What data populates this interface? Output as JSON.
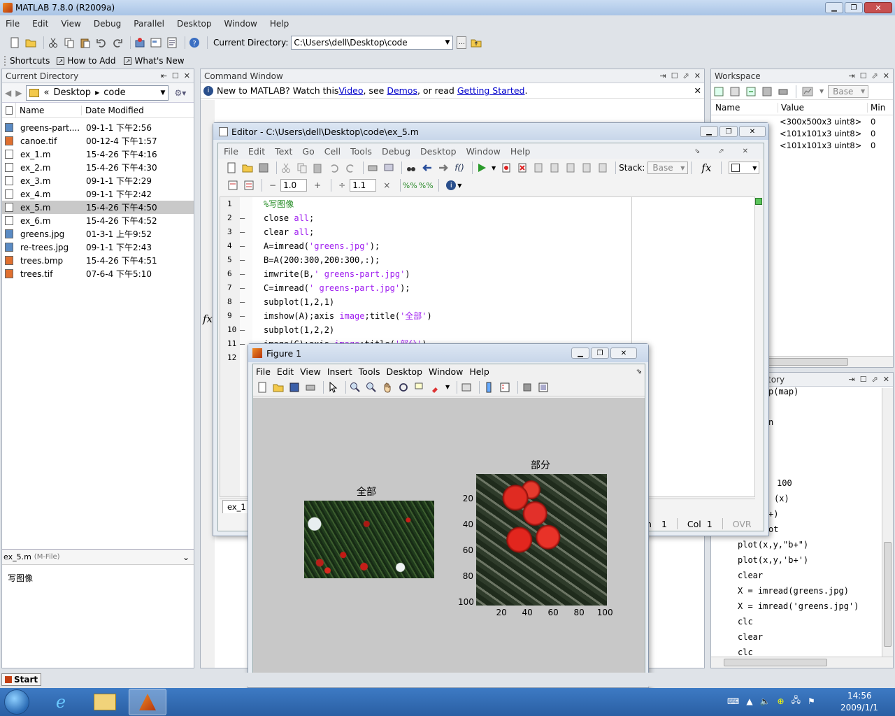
{
  "app": {
    "title": "MATLAB  7.8.0 (R2009a)"
  },
  "menubar": [
    "File",
    "Edit",
    "View",
    "Debug",
    "Parallel",
    "Desktop",
    "Window",
    "Help"
  ],
  "toolbar": {
    "curdir_label": "Current Directory:",
    "curdir_value": "C:\\Users\\dell\\Desktop\\code"
  },
  "shortcuts": {
    "label": "Shortcuts",
    "how_to_add": "How to Add",
    "whats_new": "What's New"
  },
  "current_directory": {
    "title": "Current Directory",
    "breadcrumb": [
      "«",
      "Desktop",
      "code"
    ],
    "columns": [
      "Name",
      "Date Modified"
    ],
    "files": [
      {
        "name": "greens-part....",
        "date": "09-1-1 下午2:56",
        "icon": "image-icon"
      },
      {
        "name": "canoe.tif",
        "date": "00-12-4 下午1:57",
        "icon": "tif-icon"
      },
      {
        "name": "ex_1.m",
        "date": "15-4-26 下午4:16",
        "icon": "m-file-icon"
      },
      {
        "name": "ex_2.m",
        "date": "15-4-26 下午4:30",
        "icon": "m-file-icon"
      },
      {
        "name": "ex_3.m",
        "date": "09-1-1 下午2:29",
        "icon": "m-file-icon"
      },
      {
        "name": "ex_4.m",
        "date": "09-1-1 下午2:42",
        "icon": "m-file-icon"
      },
      {
        "name": "ex_5.m",
        "date": "15-4-26 下午4:50",
        "icon": "m-file-icon"
      },
      {
        "name": "ex_6.m",
        "date": "15-4-26 下午4:52",
        "icon": "m-file-icon"
      },
      {
        "name": "greens.jpg",
        "date": "01-3-1 上午9:52",
        "icon": "image-icon"
      },
      {
        "name": "re-trees.jpg",
        "date": "09-1-1 下午2:43",
        "icon": "image-icon"
      },
      {
        "name": "trees.bmp",
        "date": "15-4-26 下午4:51",
        "icon": "tif-icon"
      },
      {
        "name": "trees.tif",
        "date": "07-6-4 下午5:10",
        "icon": "tif-icon"
      }
    ],
    "detail_title": "ex_5.m",
    "detail_type": "(M-File)",
    "detail_text": "写图像"
  },
  "command_window": {
    "title": "Command Window",
    "info_prefix": "New to MATLAB? Watch this ",
    "video": "Video",
    "see": ", see ",
    "demos": "Demos",
    "or_read": ", or read ",
    "getting_started": "Getting Started",
    "period": ".",
    "prompt": "fx"
  },
  "workspace": {
    "title": "Workspace",
    "base": "Base",
    "columns": [
      "Name",
      "Value",
      "Min"
    ],
    "vars": [
      {
        "value": "<300x500x3 uint8>",
        "min": "0"
      },
      {
        "value": "<101x101x3 uint8>",
        "min": "0"
      },
      {
        "value": "<101x101x3 uint8>",
        "min": "0"
      }
    ]
  },
  "history": {
    "title": "tory",
    "items": [
      "p(map)",
      "n",
      "100",
      "(x)",
      "+)",
      "ot",
      "plot(x,y,\"b+\")",
      "plot(x,y,'b+')",
      "clear",
      "X = imread(greens.jpg)",
      "X = imread('greens.jpg')",
      "clc",
      "clear",
      "clc"
    ]
  },
  "editor": {
    "title": "Editor - C:\\Users\\dell\\Desktop\\code\\ex_5.m",
    "menu": [
      "File",
      "Edit",
      "Text",
      "Go",
      "Cell",
      "Tools",
      "Debug",
      "Desktop",
      "Window",
      "Help"
    ],
    "stack_label": "Stack:",
    "stack_value": "Base",
    "cell_minus": "−",
    "cell_value1": "1.0",
    "cell_plus": "+",
    "cell_div": "÷",
    "cell_value2": "1.1",
    "cell_times": "×",
    "tab": "ex_1",
    "status_ln": "n",
    "status_ln_val": "1",
    "status_col": "Col",
    "status_col_val": "1",
    "status_ovr": "OVR",
    "line_numbers": [
      "1",
      "2",
      "3",
      "4",
      "5",
      "6",
      "7",
      "8",
      "9",
      "10",
      "11",
      "12"
    ]
  },
  "figure": {
    "title": "Figure 1",
    "menu": [
      "File",
      "Edit",
      "View",
      "Insert",
      "Tools",
      "Desktop",
      "Window",
      "Help"
    ],
    "left_title": "全部",
    "right_title": "部分",
    "y_ticks": [
      "20",
      "40",
      "60",
      "80",
      "100"
    ],
    "x_ticks": [
      "20",
      "40",
      "60",
      "80",
      "100"
    ]
  },
  "taskbar": {
    "start": "Start",
    "time": "14:56",
    "date": "2009/1/1"
  },
  "colors": {
    "taskbar": "#2a6bb5",
    "selected_row": "#c9c9c9",
    "figure_bg": "#c8c8c8"
  }
}
